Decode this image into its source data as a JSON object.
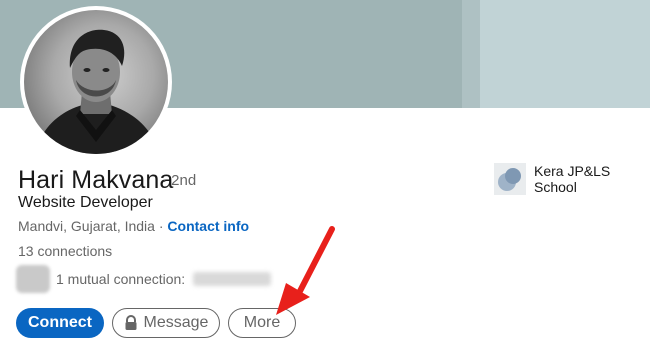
{
  "profile": {
    "name": "Hari Makvana",
    "degree": "· 2nd",
    "headline": "Website Developer",
    "location": "Mandvi, Gujarat, India · ",
    "contact_info": "Contact info",
    "connections": "13 connections",
    "mutual": "1 mutual connection:"
  },
  "company": {
    "name": "Kera JP&LS School"
  },
  "actions": {
    "connect": "Connect",
    "message": "Message",
    "more": "More"
  },
  "colors": {
    "accent": "#0a66c2",
    "annotation_arrow": "#e8201b"
  },
  "icons": {
    "message_lock": "lock-icon",
    "annotation": "red-arrow-icon"
  }
}
